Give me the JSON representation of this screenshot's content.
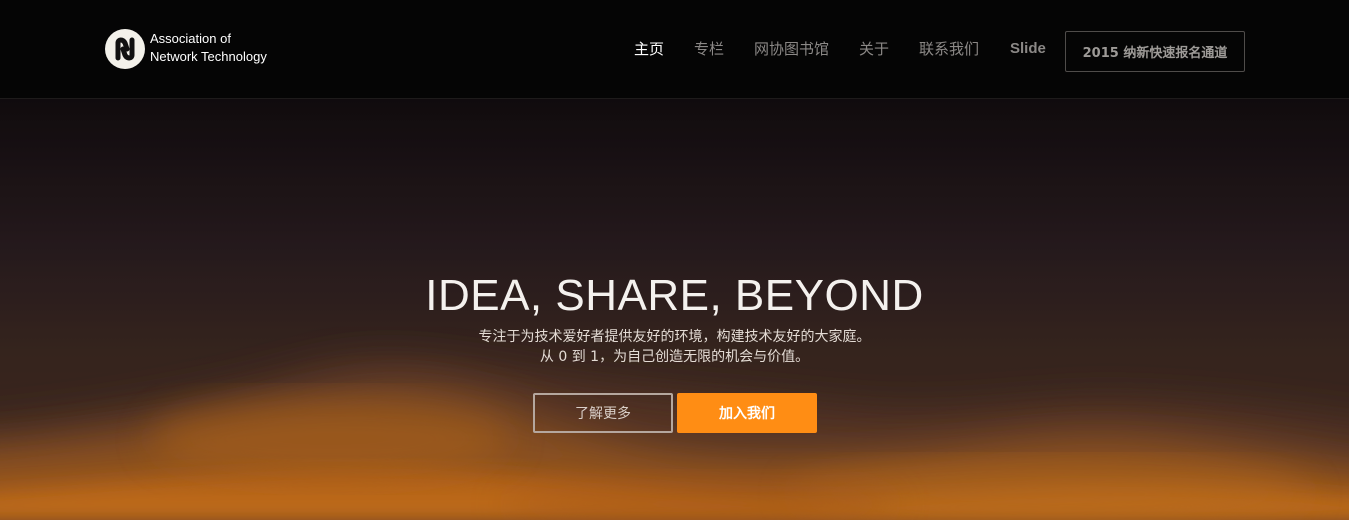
{
  "brand": {
    "line1": "Association of",
    "line2": "Network Technology"
  },
  "nav": {
    "items": [
      {
        "label": "主页",
        "active": true
      },
      {
        "label": "专栏",
        "active": false
      },
      {
        "label": "网协图书馆",
        "active": false
      },
      {
        "label": "关于",
        "active": false
      },
      {
        "label": "联系我们",
        "active": false
      },
      {
        "label": "Slide",
        "active": false
      }
    ],
    "cta_label": "2015 纳新快速报名通道"
  },
  "hero": {
    "title": "IDEA, SHARE, BEYOND",
    "subtitle_line1": "专注于为技术爱好者提供友好的环境，构建技术友好的大家庭。",
    "subtitle_line2": "从 0 到 1，为自己创造无限的机会与价值。",
    "learn_more_label": "了解更多",
    "join_label": "加入我们"
  },
  "colors": {
    "navbar_bg": "#050505",
    "accent_orange": "#ff8d14",
    "nav_active": "#ffffff",
    "nav_inactive": "#8b8886"
  }
}
